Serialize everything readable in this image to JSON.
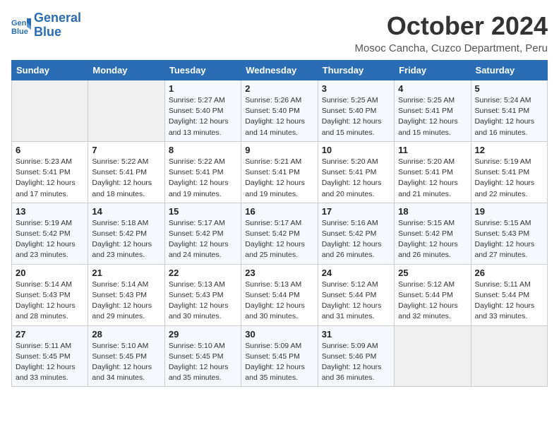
{
  "logo": {
    "line1": "General",
    "line2": "Blue"
  },
  "title": "October 2024",
  "subtitle": "Mosoc Cancha, Cuzco Department, Peru",
  "days_header": [
    "Sunday",
    "Monday",
    "Tuesday",
    "Wednesday",
    "Thursday",
    "Friday",
    "Saturday"
  ],
  "weeks": [
    [
      {
        "day": "",
        "info": ""
      },
      {
        "day": "",
        "info": ""
      },
      {
        "day": "1",
        "info": "Sunrise: 5:27 AM\nSunset: 5:40 PM\nDaylight: 12 hours and 13 minutes."
      },
      {
        "day": "2",
        "info": "Sunrise: 5:26 AM\nSunset: 5:40 PM\nDaylight: 12 hours and 14 minutes."
      },
      {
        "day": "3",
        "info": "Sunrise: 5:25 AM\nSunset: 5:40 PM\nDaylight: 12 hours and 15 minutes."
      },
      {
        "day": "4",
        "info": "Sunrise: 5:25 AM\nSunset: 5:41 PM\nDaylight: 12 hours and 15 minutes."
      },
      {
        "day": "5",
        "info": "Sunrise: 5:24 AM\nSunset: 5:41 PM\nDaylight: 12 hours and 16 minutes."
      }
    ],
    [
      {
        "day": "6",
        "info": "Sunrise: 5:23 AM\nSunset: 5:41 PM\nDaylight: 12 hours and 17 minutes."
      },
      {
        "day": "7",
        "info": "Sunrise: 5:22 AM\nSunset: 5:41 PM\nDaylight: 12 hours and 18 minutes."
      },
      {
        "day": "8",
        "info": "Sunrise: 5:22 AM\nSunset: 5:41 PM\nDaylight: 12 hours and 19 minutes."
      },
      {
        "day": "9",
        "info": "Sunrise: 5:21 AM\nSunset: 5:41 PM\nDaylight: 12 hours and 19 minutes."
      },
      {
        "day": "10",
        "info": "Sunrise: 5:20 AM\nSunset: 5:41 PM\nDaylight: 12 hours and 20 minutes."
      },
      {
        "day": "11",
        "info": "Sunrise: 5:20 AM\nSunset: 5:41 PM\nDaylight: 12 hours and 21 minutes."
      },
      {
        "day": "12",
        "info": "Sunrise: 5:19 AM\nSunset: 5:41 PM\nDaylight: 12 hours and 22 minutes."
      }
    ],
    [
      {
        "day": "13",
        "info": "Sunrise: 5:19 AM\nSunset: 5:42 PM\nDaylight: 12 hours and 23 minutes."
      },
      {
        "day": "14",
        "info": "Sunrise: 5:18 AM\nSunset: 5:42 PM\nDaylight: 12 hours and 23 minutes."
      },
      {
        "day": "15",
        "info": "Sunrise: 5:17 AM\nSunset: 5:42 PM\nDaylight: 12 hours and 24 minutes."
      },
      {
        "day": "16",
        "info": "Sunrise: 5:17 AM\nSunset: 5:42 PM\nDaylight: 12 hours and 25 minutes."
      },
      {
        "day": "17",
        "info": "Sunrise: 5:16 AM\nSunset: 5:42 PM\nDaylight: 12 hours and 26 minutes."
      },
      {
        "day": "18",
        "info": "Sunrise: 5:15 AM\nSunset: 5:42 PM\nDaylight: 12 hours and 26 minutes."
      },
      {
        "day": "19",
        "info": "Sunrise: 5:15 AM\nSunset: 5:43 PM\nDaylight: 12 hours and 27 minutes."
      }
    ],
    [
      {
        "day": "20",
        "info": "Sunrise: 5:14 AM\nSunset: 5:43 PM\nDaylight: 12 hours and 28 minutes."
      },
      {
        "day": "21",
        "info": "Sunrise: 5:14 AM\nSunset: 5:43 PM\nDaylight: 12 hours and 29 minutes."
      },
      {
        "day": "22",
        "info": "Sunrise: 5:13 AM\nSunset: 5:43 PM\nDaylight: 12 hours and 30 minutes."
      },
      {
        "day": "23",
        "info": "Sunrise: 5:13 AM\nSunset: 5:44 PM\nDaylight: 12 hours and 30 minutes."
      },
      {
        "day": "24",
        "info": "Sunrise: 5:12 AM\nSunset: 5:44 PM\nDaylight: 12 hours and 31 minutes."
      },
      {
        "day": "25",
        "info": "Sunrise: 5:12 AM\nSunset: 5:44 PM\nDaylight: 12 hours and 32 minutes."
      },
      {
        "day": "26",
        "info": "Sunrise: 5:11 AM\nSunset: 5:44 PM\nDaylight: 12 hours and 33 minutes."
      }
    ],
    [
      {
        "day": "27",
        "info": "Sunrise: 5:11 AM\nSunset: 5:45 PM\nDaylight: 12 hours and 33 minutes."
      },
      {
        "day": "28",
        "info": "Sunrise: 5:10 AM\nSunset: 5:45 PM\nDaylight: 12 hours and 34 minutes."
      },
      {
        "day": "29",
        "info": "Sunrise: 5:10 AM\nSunset: 5:45 PM\nDaylight: 12 hours and 35 minutes."
      },
      {
        "day": "30",
        "info": "Sunrise: 5:09 AM\nSunset: 5:45 PM\nDaylight: 12 hours and 35 minutes."
      },
      {
        "day": "31",
        "info": "Sunrise: 5:09 AM\nSunset: 5:46 PM\nDaylight: 12 hours and 36 minutes."
      },
      {
        "day": "",
        "info": ""
      },
      {
        "day": "",
        "info": ""
      }
    ]
  ]
}
